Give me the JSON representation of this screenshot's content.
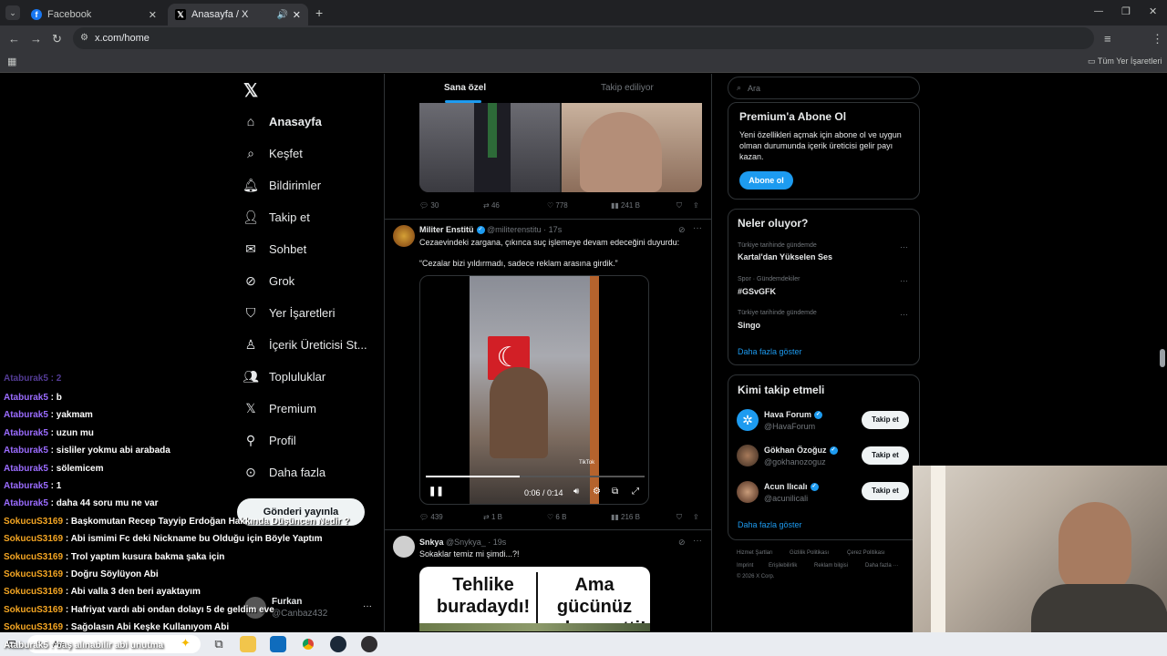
{
  "browser": {
    "tabs": [
      {
        "title": "Facebook",
        "icon": "facebook-icon"
      },
      {
        "title": "Anasayfa / X",
        "icon": "x-logo-icon"
      }
    ],
    "url": "x.com/home",
    "all_bookmarks": "Tüm Yer İşaretleri"
  },
  "nav": {
    "items": [
      "Anasayfa",
      "Keşfet",
      "Bildirimler",
      "Takip et",
      "Sohbet",
      "Grok",
      "Yer İşaretleri",
      "İçerik Üreticisi St...",
      "Topluluklar",
      "Premium",
      "Profil",
      "Daha fazla"
    ],
    "post_button": "Gönderi yayınla",
    "account_name": "Furkan",
    "account_handle": "@Canbaz432"
  },
  "chat": [
    {
      "user": "Ataburak5",
      "msg": ": b"
    },
    {
      "user": "Ataburak5",
      "msg": ": yakmam"
    },
    {
      "user": "Ataburak5",
      "msg": ": uzun mu"
    },
    {
      "user": "Ataburak5",
      "msg": ": sisliler yokmu abi arabada"
    },
    {
      "user": "Ataburak5",
      "msg": ": sölemicem"
    },
    {
      "user": "Ataburak5",
      "msg": ": 1"
    },
    {
      "user": "Ataburak5",
      "msg": ": daha 44 soru mu ne var"
    },
    {
      "user": "SokucuS3169",
      "msg": ": Başkomutan Recep Tayyip Erdoğan Hakkında Düşüncen Nedir ?"
    },
    {
      "user": "SokucuS3169",
      "msg": ": Abi ismimi Fc deki Nickname bu Olduğu için Böyle Yaptım"
    },
    {
      "user": "SokucuS3169",
      "msg": ": Trol yaptım kusura bakma şaka için"
    },
    {
      "user": "SokucuS3169",
      "msg": ": Doğru Söylüyon Abi"
    },
    {
      "user": "SokucuS3169",
      "msg": ": Abi valla 3 den beri ayaktayım"
    },
    {
      "user": "SokucuS3169",
      "msg": ": Hafriyat vardı abi ondan dolayı 5 de geldim eve"
    },
    {
      "user": "SokucuS3169",
      "msg": ": Sağolasın Abi Keşke Kullanıyom Abi"
    }
  ],
  "feed": {
    "tabs": [
      "Sana özel",
      "Takip ediliyor"
    ],
    "tweet1_stats": {
      "replies": "30",
      "reposts": "46",
      "likes": "778",
      "views": "241 B"
    },
    "tweet2": {
      "name": "Militer Enstitü",
      "handle": "@militerenstitu · 17s",
      "text": "Cezaevindeki zargana, çıkınca suç işlemeye devam edeceğini duyurdu:",
      "quote": "“Cezalar bizi yıldırmadı, sadece reklam arasına girdik.”",
      "video_time": "0:06 / 0:14",
      "video_progress": 0.43,
      "watermark": "TikTok",
      "stats": {
        "replies": "439",
        "reposts": "1 B",
        "likes": "6 B",
        "views": "216 B"
      }
    },
    "tweet3": {
      "name": "Snkya",
      "handle": "@Snykya_ · 19s",
      "text": "Sokaklar temiz mi şimdi...?!",
      "image_left": "Tehlike buradaydı!",
      "image_right": "Ama gücünüz onlara yetti!"
    }
  },
  "right": {
    "search_placeholder": "Ara",
    "premium": {
      "title": "Premium'a Abone Ol",
      "body": "Yeni özellikleri açmak için abone ol ve uygun olman durumunda içerik üreticisi gelir payı kazan.",
      "button": "Abone ol"
    },
    "trends_title": "Neler oluyor?",
    "trends": [
      {
        "meta": "Türkiye tarihinde gündemde",
        "name": "Kartal'dan Yükselen Ses"
      },
      {
        "meta": "Spor · Gündemdekiler",
        "name": "#GSvGFK"
      },
      {
        "meta": "Türkiye tarihinde gündemde",
        "name": "Singo"
      }
    ],
    "show_more": "Daha fazla göster",
    "who_title": "Kimi takip etmeli",
    "who": [
      {
        "name": "Hava Forum",
        "handle": "@HavaForum",
        "button": "Takip et"
      },
      {
        "name": "Gökhan Özoğuz",
        "handle": "@gokhanozoguz",
        "button": "Takip et"
      },
      {
        "name": "Acun Ilıcalı",
        "handle": "@acunilicali",
        "button": "Takip et"
      }
    ],
    "who_show_more": "Daha fazla göster",
    "footer": [
      "Hizmet Şartları",
      "Gizlilik Politikası",
      "Çerez Politikası",
      "Imprint",
      "Erişilebilirlik",
      "Reklam bilgisi",
      "Daha fazla ···",
      "© 2026 X Corp."
    ]
  },
  "taskbar": {
    "search": "Ara",
    "chat_overlay": "Ataburak5 : baş alınabilir abi unutma"
  }
}
